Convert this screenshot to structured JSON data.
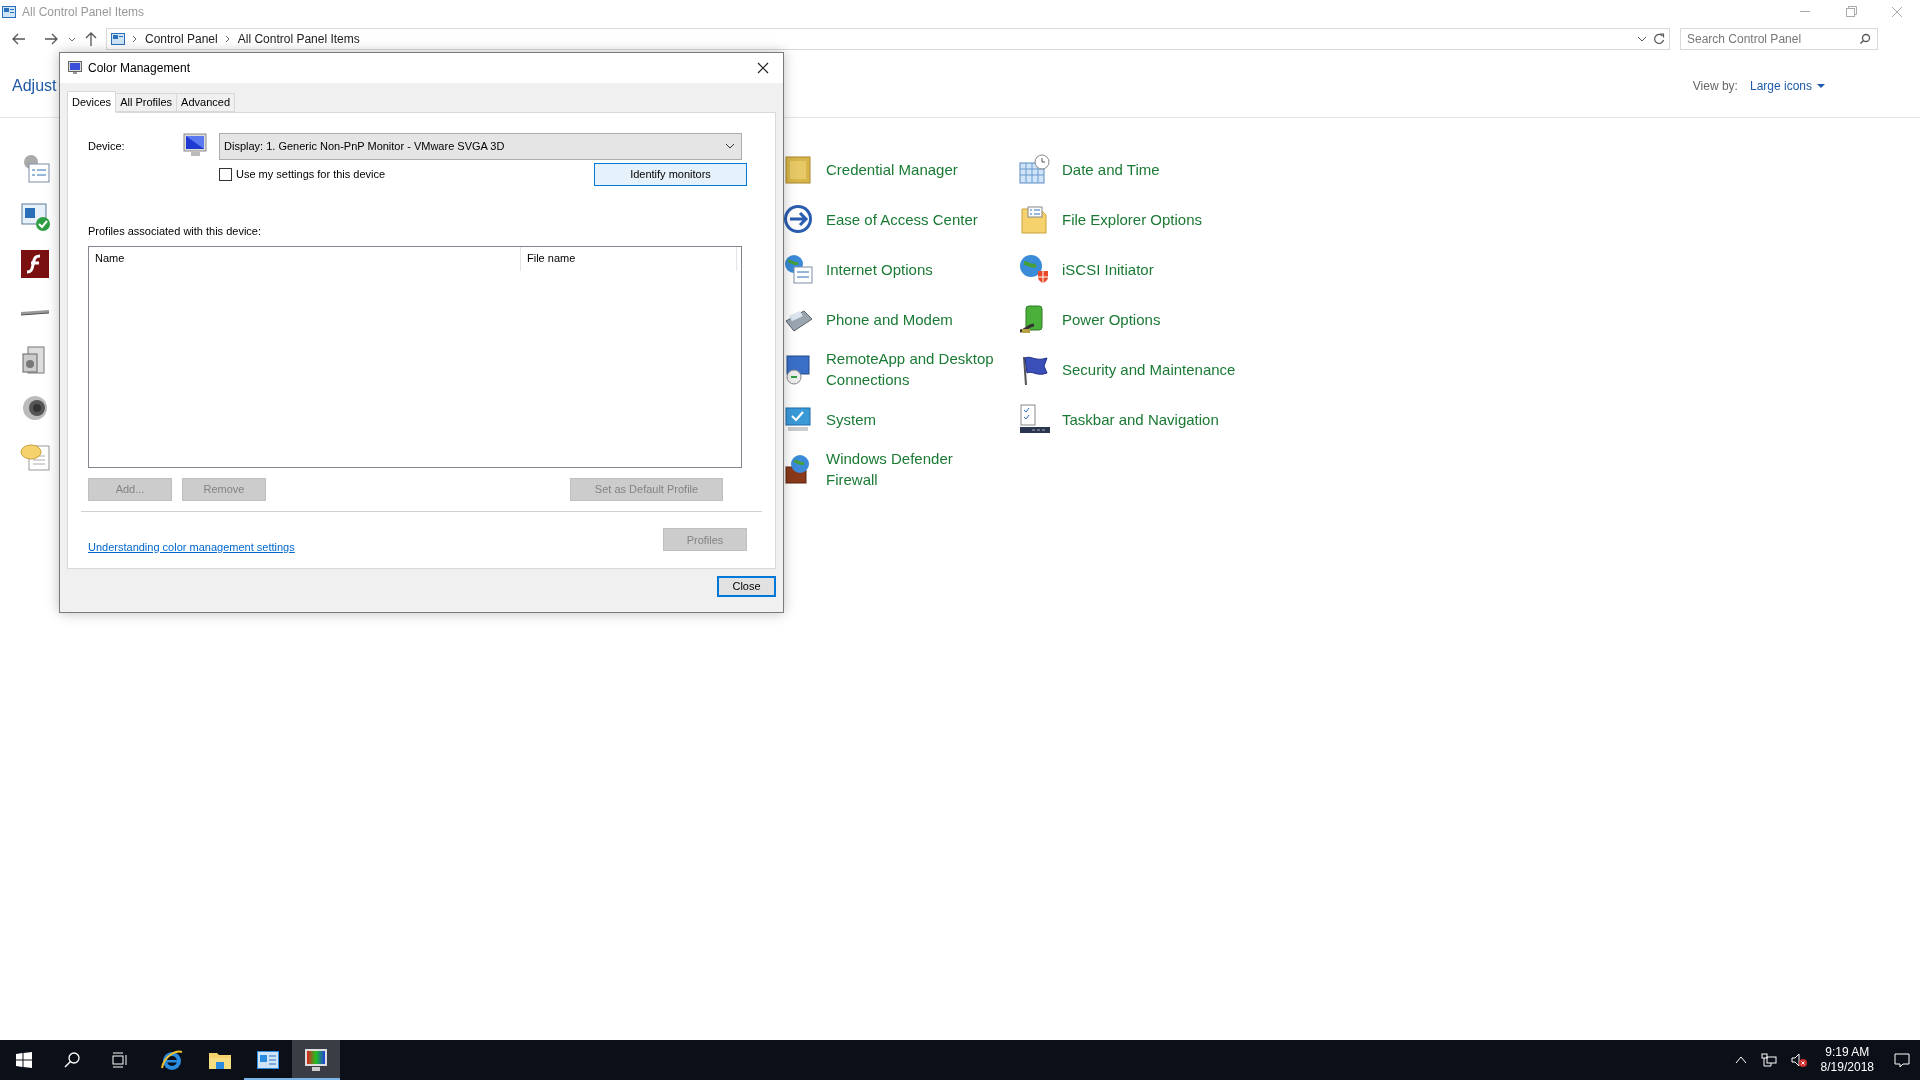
{
  "window": {
    "title": "All Control Panel Items"
  },
  "address_bar": {
    "path": [
      "Control Panel",
      "All Control Panel Items"
    ]
  },
  "search": {
    "placeholder": "Search Control Panel"
  },
  "heading": "Adjust",
  "view_by": {
    "label": "View by:",
    "value": "Large icons"
  },
  "columns": [
    [
      {
        "label": "Credential Manager"
      },
      {
        "label": "Ease of Access Center"
      },
      {
        "label": "Internet Options"
      },
      {
        "label": "Phone and Modem"
      },
      {
        "label": "RemoteApp and Desktop Connections"
      },
      {
        "label": "System"
      },
      {
        "label": "Windows Defender Firewall"
      }
    ],
    [
      {
        "label": "Date and Time"
      },
      {
        "label": "File Explorer Options"
      },
      {
        "label": "iSCSI Initiator"
      },
      {
        "label": "Power Options"
      },
      {
        "label": "Security and Maintenance"
      },
      {
        "label": "Taskbar and Navigation"
      }
    ]
  ],
  "dialog": {
    "title": "Color Management",
    "tabs": [
      {
        "label": "Devices",
        "selected": true
      },
      {
        "label": "All Profiles",
        "selected": false
      },
      {
        "label": "Advanced",
        "selected": false
      }
    ],
    "device_label": "Device:",
    "device_value": "Display: 1. Generic Non-PnP Monitor - VMware SVGA 3D",
    "checkbox": {
      "label": "Use my settings for this device",
      "checked": false
    },
    "identify_button": "Identify monitors",
    "profiles_label": "Profiles associated with this device:",
    "table_columns": [
      "Name",
      "File name"
    ],
    "buttons": [
      {
        "label": "Add...",
        "disabled": true
      },
      {
        "label": "Remove",
        "disabled": true
      },
      {
        "label": "Set as Default Profile",
        "disabled": true
      }
    ],
    "link": "Understanding color management settings",
    "profiles_button": {
      "label": "Profiles",
      "disabled": true
    },
    "close_button": "Close"
  },
  "taskbar": {
    "apps": [
      {
        "kind": "browser",
        "running": false,
        "selected": false
      },
      {
        "kind": "folder",
        "running": false,
        "selected": false
      },
      {
        "kind": "control-panel",
        "running": true,
        "selected": false
      },
      {
        "kind": "monitor",
        "running": true,
        "selected": true
      }
    ],
    "time": "9:19 AM",
    "date": "8/19/2018"
  }
}
